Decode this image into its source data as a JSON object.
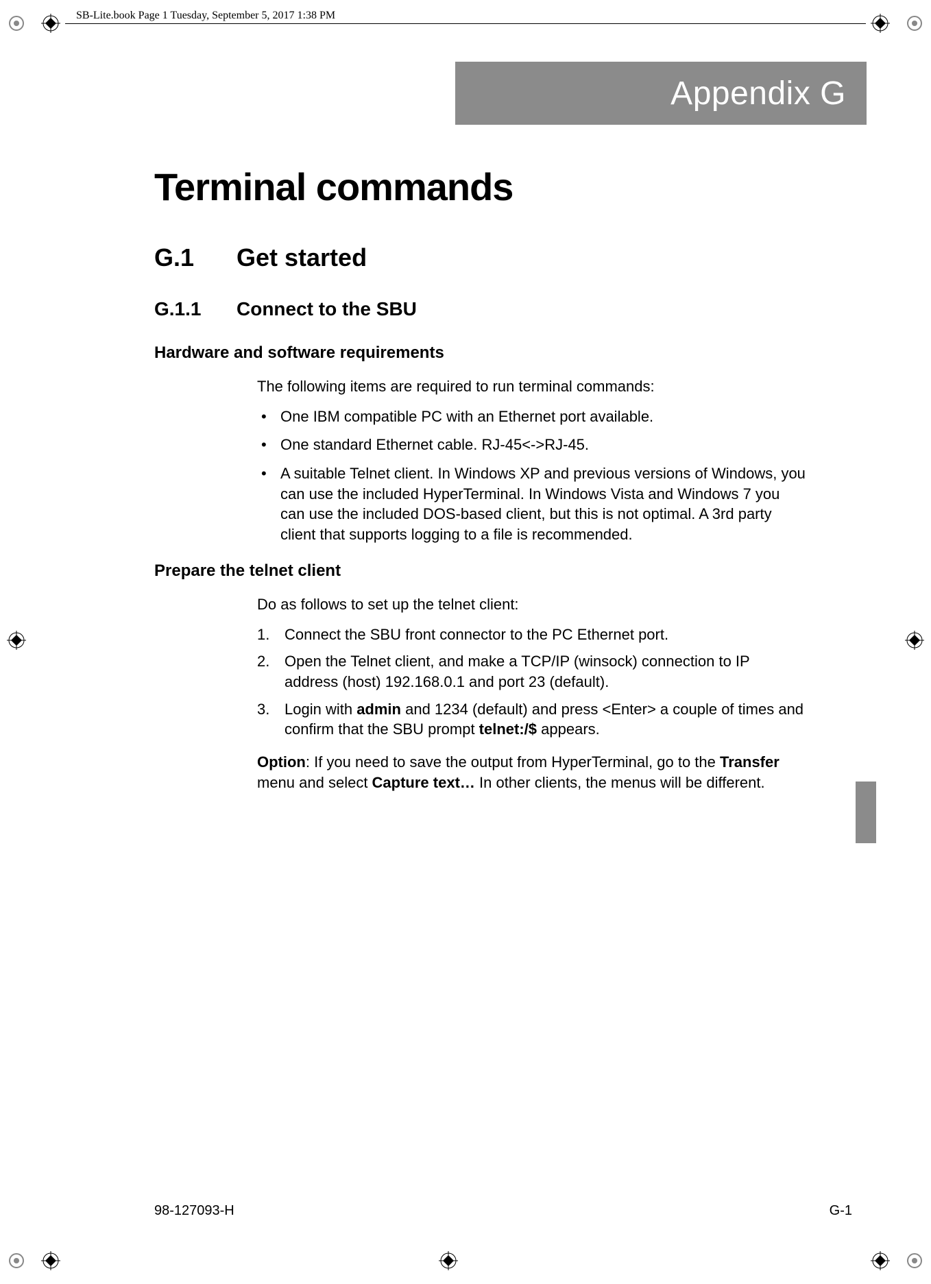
{
  "header_text": "SB-Lite.book  Page 1  Tuesday, September 5, 2017  1:38 PM",
  "appendix_label": "Appendix G",
  "title": "Terminal commands",
  "h1_num": "G.1",
  "h1_text": "Get started",
  "h2_num": "G.1.1",
  "h2_text": "Connect to the SBU",
  "h3a": "Hardware and software requirements",
  "intro_a": "The following items are required to run terminal commands:",
  "bullets": [
    "One IBM compatible PC with an Ethernet port available.",
    "One standard Ethernet cable. RJ-45<->RJ-45.",
    "A suitable Telnet client. In Windows XP and previous versions of Windows, you can use the included HyperTerminal. In Windows Vista and Windows 7 you can use the included DOS-based client, but this is not optimal. A 3rd party client that supports logging to a file is recommended."
  ],
  "h3b": "Prepare the telnet client",
  "intro_b": "Do as follows to set up the telnet client:",
  "steps": {
    "s1": "Connect the SBU front connector to the PC Ethernet port.",
    "s2": "Open the Telnet client, and make a TCP/IP (winsock) connection to IP address (host) 192.168.0.1 and port 23 (default).",
    "s3_a": "Login with ",
    "s3_b": "admin",
    "s3_c": " and 1234 (default) and press <Enter> a couple of times and confirm that the SBU prompt ",
    "s3_d": "telnet:/$",
    "s3_e": " appears."
  },
  "option": {
    "a": "Option",
    "b": ": If you need to save the output from HyperTerminal, go to the ",
    "c": "Transfer",
    "d": " menu and select ",
    "e": "Capture text…",
    "f": " In other clients, the menus will be different."
  },
  "footer_left": "98-127093-H",
  "footer_right": "G-1"
}
